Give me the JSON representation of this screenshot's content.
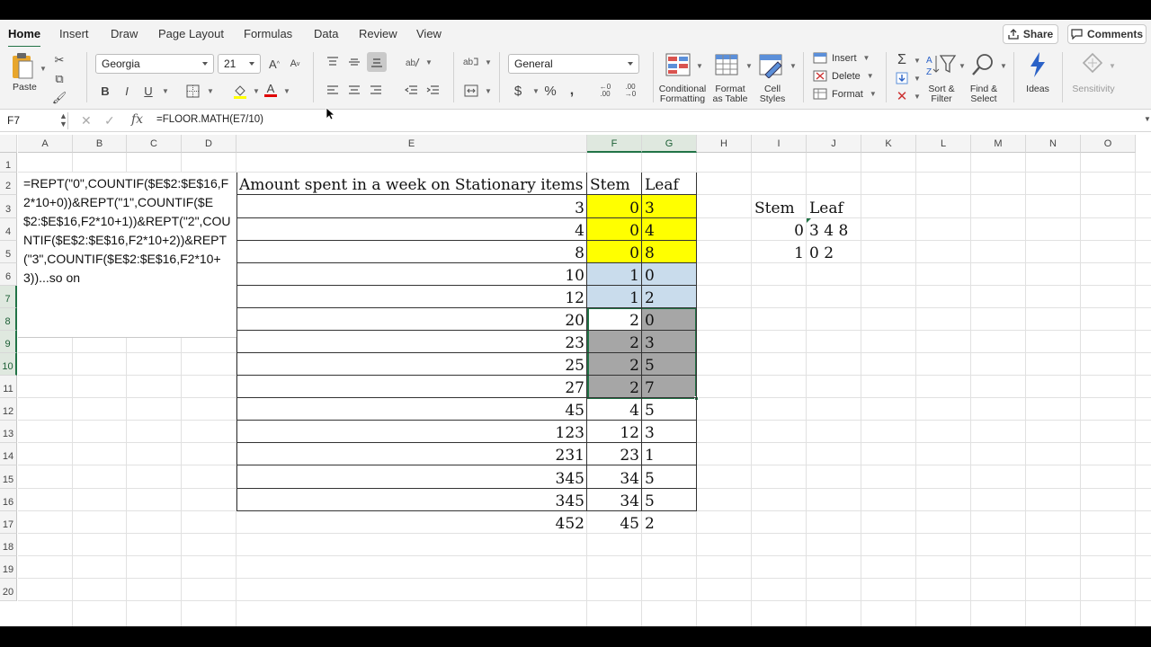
{
  "tabs": [
    "Home",
    "Insert",
    "Draw",
    "Page Layout",
    "Formulas",
    "Data",
    "Review",
    "View"
  ],
  "top_buttons": {
    "share": "Share",
    "comments": "Comments"
  },
  "ribbon": {
    "paste": "Paste",
    "font_name": "Georgia",
    "font_size": "21",
    "number_format": "General",
    "conditional_formatting": "Conditional\nFormatting",
    "format_as_table": "Format\nas Table",
    "cell_styles": "Cell\nStyles",
    "insert": "Insert",
    "delete": "Delete",
    "format": "Format",
    "sort_filter": "Sort &\nFilter",
    "find_select": "Find &\nSelect",
    "ideas": "Ideas",
    "sensitivity": "Sensitivity"
  },
  "formula_bar": {
    "name_box": "F7",
    "formula": "=FLOOR.MATH(E7/10)",
    "fx": "fx"
  },
  "columns": [
    "A",
    "B",
    "C",
    "D",
    "E",
    "F",
    "G",
    "H",
    "I",
    "J",
    "K",
    "L",
    "M",
    "N",
    "O"
  ],
  "rows": [
    "1",
    "2",
    "3",
    "4",
    "5",
    "6",
    "7",
    "8",
    "9",
    "10",
    "11",
    "12",
    "13",
    "14",
    "15",
    "16",
    "17",
    "18",
    "19",
    "20"
  ],
  "table": {
    "header_amount": "Amount spent in a week on Stationary items",
    "header_stem": "Stem",
    "header_leaf": "Leaf",
    "amounts": [
      "3",
      "4",
      "8",
      "10",
      "12",
      "20",
      "23",
      "25",
      "27",
      "45",
      "123",
      "231",
      "345",
      "345",
      "452"
    ],
    "stems": [
      "0",
      "0",
      "0",
      "1",
      "1",
      "2",
      "2",
      "2",
      "2",
      "4",
      "12",
      "23",
      "34",
      "34",
      "45"
    ],
    "leaves": [
      "3",
      "4",
      "8",
      "0",
      "2",
      "0",
      "3",
      "5",
      "7",
      "5",
      "3",
      "1",
      "5",
      "5",
      "2"
    ]
  },
  "summary": {
    "header_stem": "Stem",
    "header_leaf": "Leaf",
    "rows": [
      {
        "stem": "0",
        "leaf": "3 4 8"
      },
      {
        "stem": "1",
        "leaf": "0 2"
      }
    ]
  },
  "note_text": "=REPT(\"0\",COUNTIF($E$2:$E$16,F2*10+0))&REPT(\"1\",COUNTIF($E$2:$E$16,F2*10+1))&REPT(\"2\",COUNTIF($E$2:$E$16,F2*10+2))&REPT(\"3\",COUNTIF($E$2:$E$16,F2*10+3))...so on",
  "colors": {
    "accent": "#217346",
    "yellow": "#ffff00",
    "blue": "#c9dcec",
    "gray": "#a6a6a6"
  }
}
